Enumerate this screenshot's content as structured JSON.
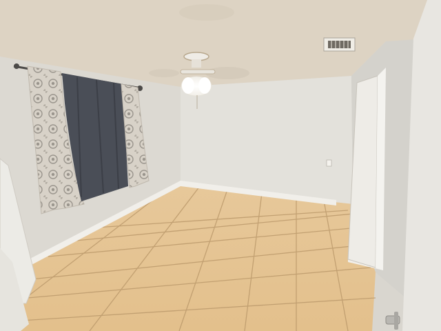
{
  "scene": {
    "kind": "photo",
    "subject": "empty-bedroom",
    "colors": {
      "ceiling": "#ddd3c3",
      "wall_back": "#e2e0da",
      "wall_left": "#dcd9d2",
      "wall_right": "#d4d2cc",
      "floor": "#e6c79a",
      "grout": "#b8976a",
      "baseboard": "#f1efea",
      "curtain_pattern": "#cfc9c0",
      "curtain_dark": "#4a4e57",
      "door": "#ecebe6"
    },
    "icons": [
      "ceiling-fan-icon",
      "air-vent-icon",
      "door-handle-icon",
      "outlet-icon"
    ]
  }
}
